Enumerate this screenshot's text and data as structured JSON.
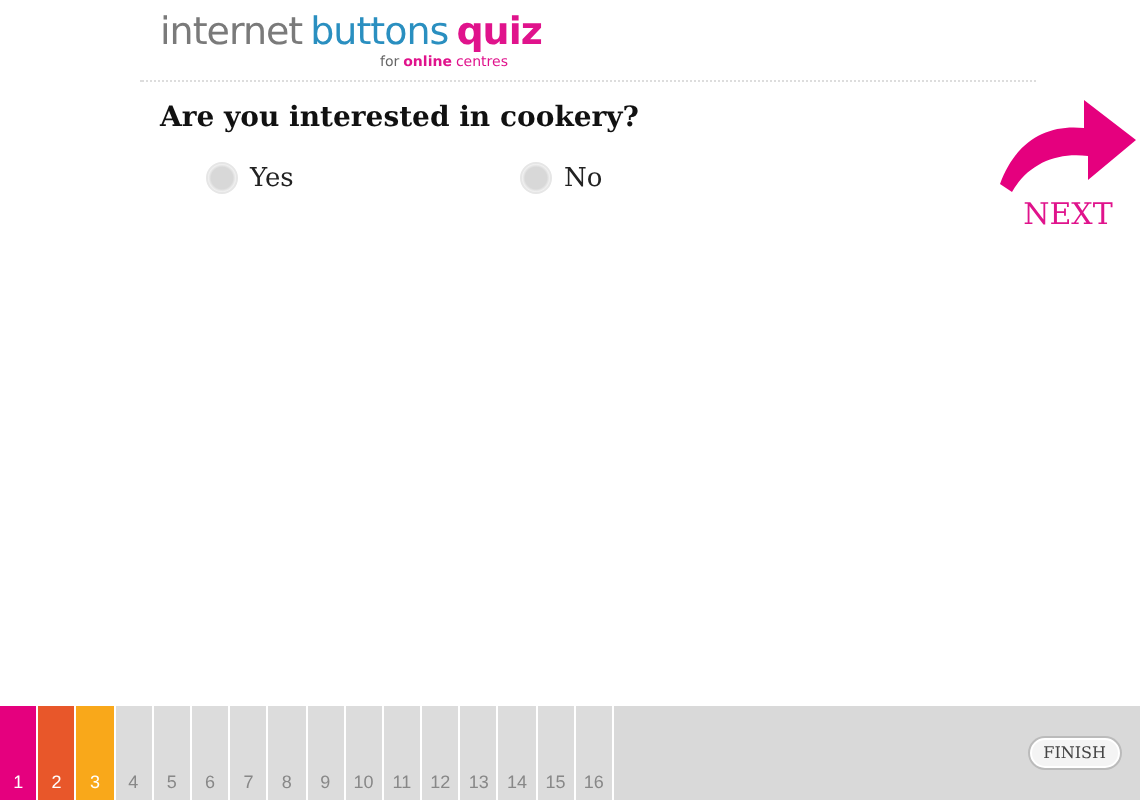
{
  "logo": {
    "words": [
      {
        "text": "internet",
        "color": "#7a7a7a"
      },
      {
        "text": "buttons",
        "color": "#2a8fc0"
      },
      {
        "text": "quiz",
        "color": "#e0138c"
      }
    ],
    "tagline": [
      {
        "text": "for",
        "color": "#666666"
      },
      {
        "text": "online",
        "color": "#e0138c"
      },
      {
        "text": "centres",
        "color": "#e0138c"
      }
    ]
  },
  "question": "Are you interested in cookery?",
  "options": [
    {
      "label": "Yes",
      "selected": false
    },
    {
      "label": "No",
      "selected": false
    }
  ],
  "next": {
    "label": "NEXT"
  },
  "progress": [
    {
      "label": "1",
      "color": "#e5007e"
    },
    {
      "label": "2",
      "color": "#e8572a"
    },
    {
      "label": "3",
      "color": "#f9a81a"
    },
    {
      "label": "4",
      "color": "#dcdcdc"
    },
    {
      "label": "5",
      "color": "#dcdcdc"
    },
    {
      "label": "6",
      "color": "#dcdcdc"
    },
    {
      "label": "7",
      "color": "#dcdcdc"
    },
    {
      "label": "8",
      "color": "#dcdcdc"
    },
    {
      "label": "9",
      "color": "#dcdcdc"
    },
    {
      "label": "10",
      "color": "#dcdcdc"
    },
    {
      "label": "11",
      "color": "#dcdcdc"
    },
    {
      "label": "12",
      "color": "#dcdcdc"
    },
    {
      "label": "13",
      "color": "#dcdcdc"
    },
    {
      "label": "14",
      "color": "#dcdcdc"
    },
    {
      "label": "15",
      "color": "#dcdcdc"
    },
    {
      "label": "16",
      "color": "#dcdcdc"
    }
  ],
  "finish": "FINISH"
}
